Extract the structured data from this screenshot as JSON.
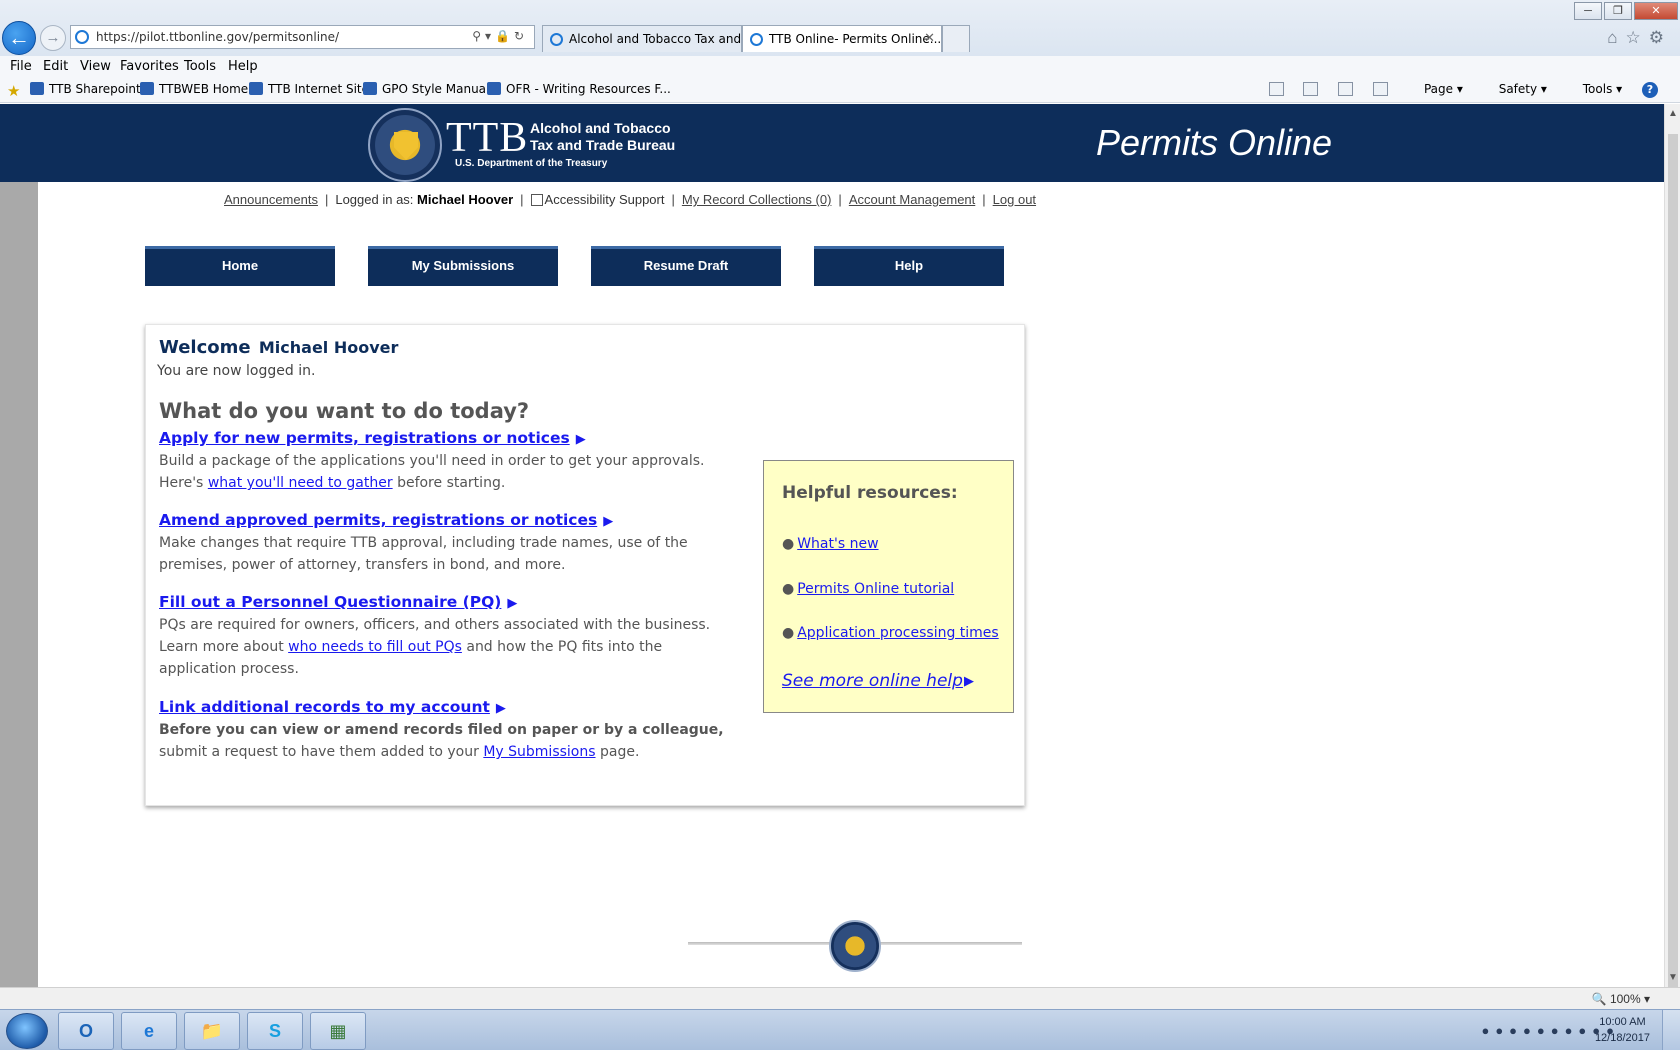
{
  "browser": {
    "url": "https://pilot.ttbonline.gov/permitsonline/",
    "tabs": [
      {
        "label": "Alcohol and Tobacco Tax and ...",
        "active": false
      },
      {
        "label": "TTB Online- Permits Online...",
        "active": true
      }
    ],
    "menu": [
      "File",
      "Edit",
      "View",
      "Favorites",
      "Tools",
      "Help"
    ],
    "favorites": [
      "TTB Sharepoint",
      "TTBWEB Home",
      "TTB Internet Site",
      "GPO Style Manual",
      "OFR - Writing Resources F..."
    ],
    "command_bar": {
      "page": "Page",
      "safety": "Safety",
      "tools": "Tools"
    },
    "zoom": "100%"
  },
  "header": {
    "logo_text": "TTB",
    "bureau_line1": "Alcohol and Tobacco",
    "bureau_line2": "Tax and Trade Bureau",
    "department": "U.S. Department of the Treasury",
    "site_title": "Permits Online"
  },
  "utility": {
    "announcements": "Announcements",
    "logged_in_label": "Logged in as:",
    "user_name": "Michael Hoover",
    "accessibility": "Accessibility Support",
    "record_collections": "My Record Collections (0)",
    "account_management": "Account Management",
    "logout": "Log out"
  },
  "nav": {
    "home": "Home",
    "submissions": "My Submissions",
    "resume": "Resume Draft",
    "help": "Help"
  },
  "welcome": {
    "greeting": "Welcome",
    "name": "Michael Hoover",
    "status": "You are now logged in.",
    "question": "What do you want to do today?"
  },
  "tasks": [
    {
      "title": "Apply for new permits, registrations or notices",
      "desc_1": "Build a package of the applications you'll need in order to get your approvals.",
      "desc_2a": "Here's",
      "desc_link": "what you'll need to gather",
      "desc_2b": "before starting."
    },
    {
      "title": "Amend approved permits, registrations or notices",
      "desc_1": "Make changes that require TTB approval, including trade names, use of the",
      "desc_2": "premises, power of attorney, transfers in bond, and more."
    },
    {
      "title": "Fill out a Personnel Questionnaire (PQ)",
      "desc_1": "PQs are required for owners, officers, and others associated with the business.",
      "desc_2a": "Learn more about",
      "desc_link": "who needs to fill out PQs",
      "desc_2b": "and how the PQ fits into the",
      "desc_3": "application process."
    },
    {
      "title": "Link additional records to my account",
      "desc_1": "Before you can view or amend records filed on paper or by a colleague,",
      "desc_2a": "submit a request to have them added to your",
      "desc_link": "My Submissions",
      "desc_2b": "page."
    }
  ],
  "resources": {
    "title": "Helpful resources:",
    "items": [
      "What's new",
      "Permits Online tutorial",
      "Application processing times"
    ],
    "see_more": "See more online help"
  },
  "taskbar": {
    "time": "10:00 AM",
    "date": "12/18/2017"
  }
}
